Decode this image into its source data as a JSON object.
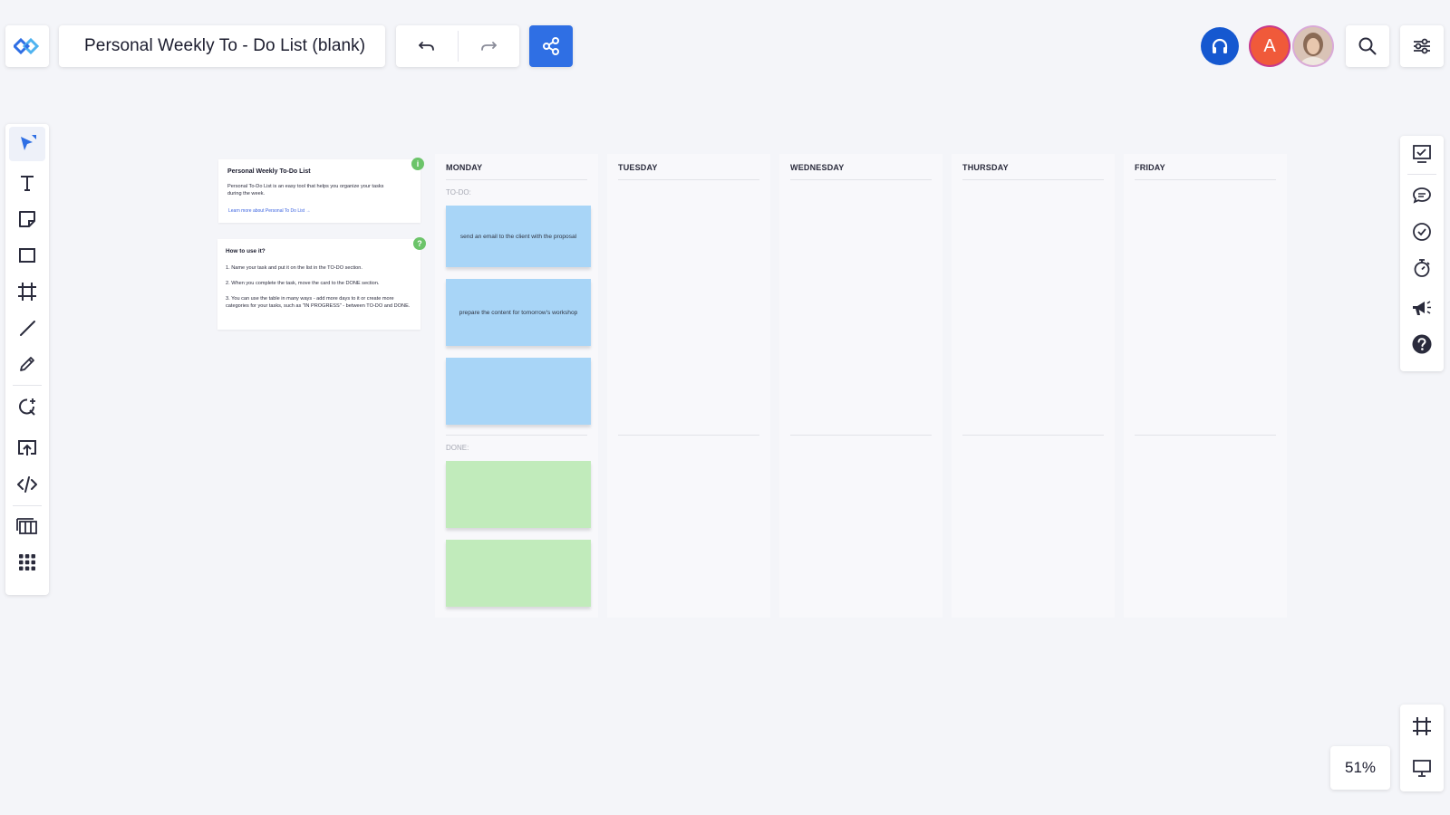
{
  "header": {
    "board_title": "Personal Weekly To - Do List (blank)",
    "avatar_letter": "A"
  },
  "zoom": {
    "level": "51%"
  },
  "info_card": {
    "title": "Personal Weekly To-Do List",
    "description": "Personal To-Do List is an easy tool that helps you organize your tasks during the week.",
    "link": "Learn more about Personal To Do List →",
    "badge": "i"
  },
  "howto_card": {
    "title": "How to use it?",
    "steps": [
      "1. Name your task and put it on the list in the TO-DO section.",
      "2. When you complete the task, move the card to the DONE section.",
      "3. You can use the table in many ways - add more days to it or create more categories for your tasks, such as \"IN PROGRESS\" - between TO-DO and DONE."
    ],
    "badge": "?"
  },
  "board": {
    "days": [
      "MONDAY",
      "TUESDAY",
      "WEDNESDAY",
      "THURSDAY",
      "FRIDAY"
    ],
    "todo_label": "TO-DO:",
    "done_label": "DONE:",
    "monday_todo": [
      "send an email to the client with the proposal",
      "prepare the content for tomorrow's workshop",
      ""
    ],
    "monday_done": [
      "",
      ""
    ]
  },
  "colors": {
    "accent": "#2f6fe4",
    "sticky_blue": "#a8d5f7",
    "sticky_green": "#c1ebbb",
    "badge_green": "#6cc46a",
    "avatar_a": "#f05a3a",
    "support": "#1558d0"
  },
  "icons": {
    "logo": "conceptboard-logo",
    "left_toolbar": [
      "select-arrow-icon",
      "text-icon",
      "sticky-note-icon",
      "rectangle-icon",
      "frame-icon",
      "line-icon",
      "pen-icon",
      "shape-add-icon",
      "upload-icon",
      "embed-code-icon",
      "table-icon",
      "apps-grid-icon"
    ],
    "right_toolbar": [
      "board-checklist-icon",
      "comments-icon",
      "tasks-check-icon",
      "timer-icon",
      "announcements-icon",
      "help-icon"
    ]
  }
}
